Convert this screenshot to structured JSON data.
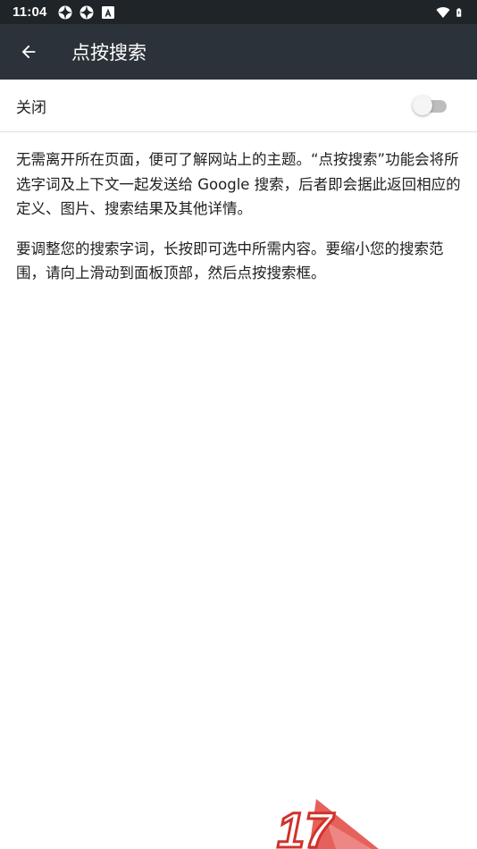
{
  "status_bar": {
    "time": "11:04",
    "left_icons": [
      "sync-icon",
      "sync-icon",
      "a-icon"
    ],
    "right_icons": [
      "wifi-icon",
      "battery-icon"
    ]
  },
  "app_bar": {
    "back_icon": "arrow-back-icon",
    "title": "点按搜索"
  },
  "toggle": {
    "label": "关闭",
    "state": "off"
  },
  "description": {
    "paragraph1": "无需离开所在页面，便可了解网站上的主题。“点按搜索”功能会将所选字词及上下文一起发送给 Google 搜索，后者即会据此返回相应的定义、图片、搜索结果及其他详情。",
    "paragraph2": "要调整您的搜索字词，长按即可选中所需内容。要缩小您的搜索范围，请向上滑动到面板顶部，然后点按搜索框。"
  },
  "watermark": {
    "text": "17"
  },
  "colors": {
    "status_bar_bg": "#1f2428",
    "app_bar_bg": "#2b3239",
    "switch_track_off": "#bdbdbd",
    "switch_thumb_off": "#f5f5f5",
    "watermark_red": "#e0453f"
  }
}
